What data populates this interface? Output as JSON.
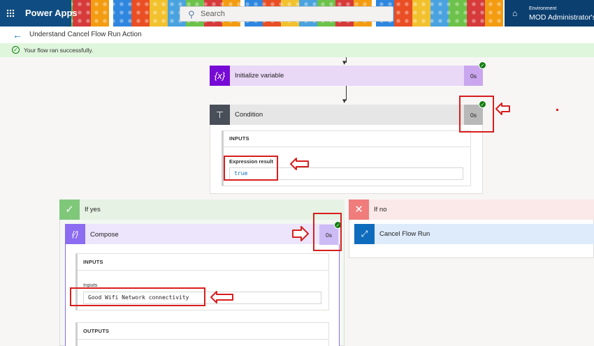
{
  "header": {
    "app_name": "Power Apps",
    "search_placeholder": "Search",
    "environment_label": "Environment",
    "environment_name": "MOD Administrator's E"
  },
  "subheader": {
    "flow_title": "Understand Cancel Flow Run Action"
  },
  "banner": {
    "message": "Your flow ran successfully."
  },
  "steps": {
    "init_variable": {
      "title": "Initialize variable",
      "duration": "0s",
      "icon": "variable-icon"
    },
    "condition": {
      "title": "Condition",
      "duration": "0s",
      "icon": "condition-icon",
      "inputs_label": "INPUTS",
      "expression_label": "Expression result",
      "expression_value": "true"
    }
  },
  "branches": {
    "yes": {
      "label": "If yes",
      "accent": "#7fc87a"
    },
    "no": {
      "label": "If no",
      "accent": "#f07c7c"
    }
  },
  "compose": {
    "title": "Compose",
    "duration": "0s",
    "icon": "compose-icon",
    "inputs_label": "INPUTS",
    "field_label": "Inputs",
    "field_value": "Good Wifi Network connectivity",
    "outputs_label": "OUTPUTS"
  },
  "cancel_flow": {
    "title": "Cancel Flow Run",
    "icon": "cancel-flow-icon"
  },
  "colors": {
    "variable_accent": "#770bd6",
    "variable_bg": "#ead8f7",
    "condition_accent": "#484f58",
    "condition_bg": "#e6e6e6",
    "compose_accent": "#8c6cf0",
    "compose_bg": "#ece5fb",
    "cancel_accent": "#0f6cbd",
    "annotation": "#d81e1e"
  }
}
